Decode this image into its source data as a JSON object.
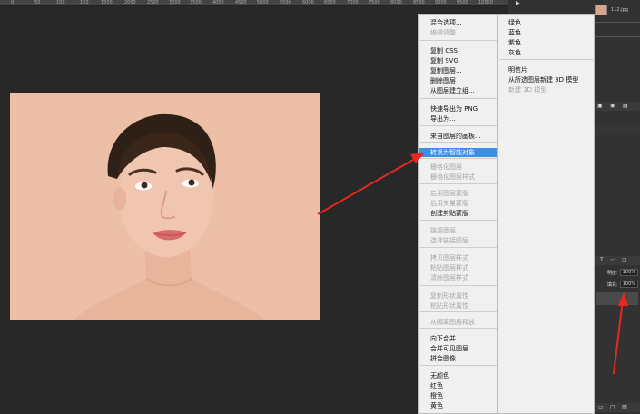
{
  "ruler": {
    "ticks": [
      "0",
      "50",
      "100",
      "150",
      "1500",
      "2000",
      "2500",
      "3000",
      "3500",
      "4000",
      "4500",
      "5000",
      "5500",
      "6000",
      "6500",
      "7000",
      "7500",
      "8000",
      "8500",
      "9000",
      "9500",
      "10000"
    ]
  },
  "layers_panel": {
    "layer_name": "112.jpg",
    "opacity_label": "明度:",
    "opacity_value": "100%",
    "fill_label": "填充:",
    "fill_value": "100%"
  },
  "context_menu": {
    "items": [
      {
        "label": "混合选项...",
        "disabled": false
      },
      {
        "label": "编辑调整...",
        "disabled": true
      },
      {
        "label": "复制 CSS",
        "disabled": false
      },
      {
        "label": "复制 SVG",
        "disabled": false
      },
      {
        "label": "复制图层...",
        "disabled": false
      },
      {
        "label": "删除图层",
        "disabled": false
      },
      {
        "label": "从图层建立组...",
        "disabled": false
      },
      {
        "label": "快速导出为 PNG",
        "disabled": false
      },
      {
        "label": "导出为...",
        "disabled": false
      },
      {
        "label": "来自图层的画板...",
        "disabled": false
      },
      {
        "label": "转换为智能对象",
        "disabled": false,
        "highlighted": true
      },
      {
        "label": "栅格化图层",
        "disabled": true
      },
      {
        "label": "栅格化图层样式",
        "disabled": true
      },
      {
        "label": "启用图层蒙版",
        "disabled": true
      },
      {
        "label": "启用矢量蒙版",
        "disabled": true
      },
      {
        "label": "创建剪贴蒙版",
        "disabled": false
      },
      {
        "label": "链接图层",
        "disabled": true
      },
      {
        "label": "选择链接图层",
        "disabled": true
      },
      {
        "label": "拷贝图层样式",
        "disabled": true
      },
      {
        "label": "粘贴图层样式",
        "disabled": true
      },
      {
        "label": "清除图层样式",
        "disabled": true
      },
      {
        "label": "复制形状属性",
        "disabled": true
      },
      {
        "label": "粘贴形状属性",
        "disabled": true
      },
      {
        "label": "从隔离图层释放",
        "disabled": true
      },
      {
        "label": "向下合并",
        "disabled": false
      },
      {
        "label": "合并可见图层",
        "disabled": false
      },
      {
        "label": "拼合图像",
        "disabled": false
      },
      {
        "label": "无颜色",
        "disabled": false
      },
      {
        "label": "红色",
        "disabled": false
      },
      {
        "label": "橙色",
        "disabled": false
      },
      {
        "label": "黄色",
        "disabled": false
      }
    ]
  },
  "submenu": {
    "items": [
      {
        "label": "绿色",
        "disabled": false
      },
      {
        "label": "蓝色",
        "disabled": false
      },
      {
        "label": "紫色",
        "disabled": false
      },
      {
        "label": "灰色",
        "disabled": false
      },
      {
        "label": "明信片",
        "disabled": false
      },
      {
        "label": "从所选图层新建 3D 模型",
        "disabled": false
      },
      {
        "label": "新建 3D 模型",
        "disabled": true
      }
    ]
  },
  "colors": {
    "highlight": "#3e8ee6",
    "arrow": "#e8281e",
    "skin_background": "#ecbfa6"
  }
}
